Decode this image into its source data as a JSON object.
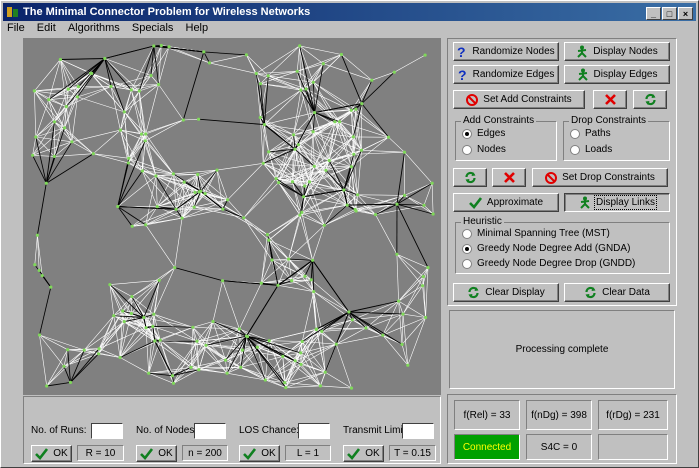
{
  "window": {
    "title": "The Minimal Connector Problem for Wireless Networks",
    "controls": [
      "_",
      "□",
      "×"
    ]
  },
  "menu": [
    "File",
    "Edit",
    "Algorithms",
    "Specials",
    "Help"
  ],
  "buttons": {
    "randomize_nodes": "Randomize Nodes",
    "display_nodes": "Display Nodes",
    "randomize_edges": "Randomize Edges",
    "display_edges": "Display Edges",
    "set_add_constraints": "Set Add Constraints",
    "set_drop_constraints": "Set Drop Constraints",
    "approximate": "Approximate",
    "display_links": "Display Links",
    "clear_display": "Clear Display",
    "clear_data": "Clear Data"
  },
  "add_constraints": {
    "label": "Add Constraints",
    "options": [
      {
        "label": "Edges",
        "selected": true
      },
      {
        "label": "Nodes",
        "selected": false
      }
    ]
  },
  "drop_constraints": {
    "label": "Drop Constraints",
    "options": [
      {
        "label": "Paths",
        "selected": false
      },
      {
        "label": "Loads",
        "selected": false
      }
    ]
  },
  "heuristic": {
    "label": "Heuristic",
    "options": [
      {
        "label": "Minimal Spanning Tree (MST)",
        "selected": false
      },
      {
        "label": "Greedy Node Degree Add (GNDA)",
        "selected": true
      },
      {
        "label": "Greedy Node Degree Drop (GNDD)",
        "selected": false
      }
    ]
  },
  "status_message": "Processing complete",
  "results": {
    "f_rel": "f(Rel) = 33",
    "f_ndg": "f(nDg) = 398",
    "f_rdg": "f(rDg) = 231",
    "connected": "Connected",
    "s4c": "S4C = 0",
    "empty": ""
  },
  "params": [
    {
      "label": "No. of Runs:",
      "value": "",
      "ok": "OK",
      "current": "R = 10"
    },
    {
      "label": "No. of Nodes:",
      "value": "",
      "ok": "OK",
      "current": "n = 200"
    },
    {
      "label": "LOS Chance:",
      "value": "",
      "ok": "OK",
      "current": "L = 1"
    },
    {
      "label": "Transmit Limit:",
      "value": "",
      "ok": "OK",
      "current": "T = 0.15"
    }
  ],
  "colors": {
    "title_bar": "#0a246a",
    "graph_bg": "#808080",
    "edges": "#ffffff",
    "links": "#000000",
    "nodes": "#7fd85a",
    "connected_bg": "#00a000",
    "connected_text": "#ffff00",
    "help_icon": "#1030c0",
    "stop_icon": "#e00000",
    "refresh_icon": "#108020",
    "check_icon": "#108020"
  },
  "icons": {
    "help": "question-mark-icon",
    "display": "stick-figure-icon",
    "stop": "no-entry-icon",
    "cancel": "red-x-icon",
    "refresh": "green-refresh-icon",
    "ok": "green-check-icon"
  }
}
